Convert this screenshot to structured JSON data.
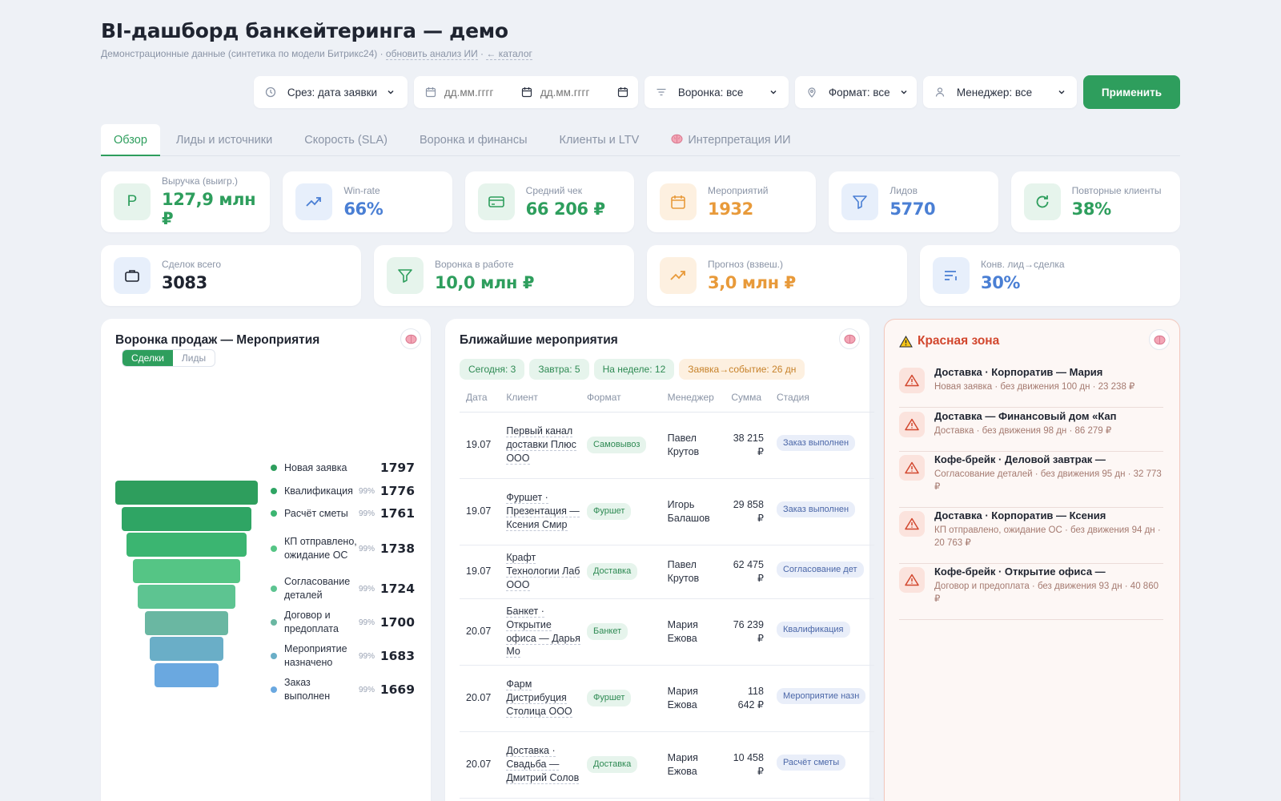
{
  "header": {
    "title": "BI-дашборд банкейтеринга — демо",
    "subtitle_prefix": "Демонстрационные данные (синтетика по модели Битрикс24) ·",
    "refresh_link": "обновить анализ ИИ",
    "separator": "·",
    "catalog_link": "← каталог"
  },
  "filters": {
    "slice": "Срез: дата заявки",
    "date_from_placeholder": "дд.мм.гггг",
    "date_to_placeholder": "дд.мм.гггг",
    "funnel": "Воронка: все",
    "format": "Формат: все",
    "manager": "Менеджер: все",
    "apply": "Применить"
  },
  "tabs": [
    {
      "label": "Обзор",
      "active": true
    },
    {
      "label": "Лиды и источники"
    },
    {
      "label": "Скорость (SLA)"
    },
    {
      "label": "Воронка и финансы"
    },
    {
      "label": "Клиенты и LTV"
    },
    {
      "label": "Интерпретация ИИ",
      "icon": "brain-icon"
    }
  ],
  "kpi_row1": [
    {
      "label": "Выручка (выигр.)",
      "value": "127,9 млн ₽",
      "color": "#2e9e5d",
      "bg": "#e6f4ec",
      "icon": "ruble-icon"
    },
    {
      "label": "Win-rate",
      "value": "66%",
      "color": "#4a7fd4",
      "bg": "#e7effb",
      "icon": "trend-up-icon"
    },
    {
      "label": "Средний чек",
      "value": "66 206 ₽",
      "color": "#2e9e5d",
      "bg": "#e6f4ec",
      "icon": "card-icon"
    },
    {
      "label": "Мероприятий",
      "value": "1932",
      "color": "#e89a3a",
      "bg": "#fdf0e0",
      "icon": "calendar-icon"
    },
    {
      "label": "Лидов",
      "value": "5770",
      "color": "#4a7fd4",
      "bg": "#e7effb",
      "icon": "filter-icon"
    },
    {
      "label": "Повторные клиенты",
      "value": "38%",
      "color": "#2e9e5d",
      "bg": "#e6f4ec",
      "icon": "refresh-icon"
    }
  ],
  "kpi_row2": [
    {
      "label": "Сделок всего",
      "value": "3083",
      "color": "#1f2430",
      "bg": "#e7effb",
      "icon": "briefcase-icon"
    },
    {
      "label": "Воронка в работе",
      "value": "10,0 млн ₽",
      "color": "#2e9e5d",
      "bg": "#e6f4ec",
      "icon": "filter-icon"
    },
    {
      "label": "Прогноз (взвеш.)",
      "value": "3,0 млн ₽",
      "color": "#e89a3a",
      "bg": "#fdf0e0",
      "icon": "trend-up-icon"
    },
    {
      "label": "Конв. лид→сделка",
      "value": "30%",
      "color": "#4a7fd4",
      "bg": "#e7effb",
      "icon": "list-icon"
    }
  ],
  "funnel_panel": {
    "title": "Воронка продаж — Мероприятия",
    "toggle_deals": "Сделки",
    "toggle_leads": "Лиды",
    "stages": [
      {
        "name": "Новая заявка",
        "pct": "",
        "value": 1797,
        "color": "#2e9e5d"
      },
      {
        "name": "Квалификация",
        "pct": "99%",
        "value": 1776,
        "color": "#2fa564"
      },
      {
        "name": "Расчёт сметы",
        "pct": "99%",
        "value": 1761,
        "color": "#3bb571"
      },
      {
        "name": "КП отправлено, ожидание ОС",
        "pct": "99%",
        "value": 1738,
        "color": "#55c585"
      },
      {
        "name": "Согласование деталей",
        "pct": "99%",
        "value": 1724,
        "color": "#5dc491"
      },
      {
        "name": "Договор и предоплата",
        "pct": "99%",
        "value": 1700,
        "color": "#6ab7a2"
      },
      {
        "name": "Мероприятие назначено",
        "pct": "99%",
        "value": 1683,
        "color": "#6aaec7"
      },
      {
        "name": "Заказ выполнен",
        "pct": "99%",
        "value": 1669,
        "color": "#6aa8e0"
      }
    ]
  },
  "events_panel": {
    "title": "Ближайшие мероприятия",
    "chips": [
      {
        "label": "Сегодня: 3",
        "bg": "#e6f4ec",
        "color": "#2e8a53"
      },
      {
        "label": "Завтра: 5",
        "bg": "#e6f4ec",
        "color": "#2e8a53"
      },
      {
        "label": "На неделе: 12",
        "bg": "#e6f4ec",
        "color": "#2e8a53"
      },
      {
        "label": "Заявка→событие: 26 дн",
        "bg": "#fdf0e0",
        "color": "#c7822a"
      }
    ],
    "columns": [
      "Дата",
      "Клиент",
      "Формат",
      "Менеджер",
      "Сумма",
      "Стадия"
    ],
    "rows": [
      {
        "date": "19.07",
        "client": "Первый канал доставки Плюс ООО",
        "format": "Самовывоз",
        "manager": "Павел Крутов",
        "sum": "38 215 ₽",
        "stage": "Заказ выполнен"
      },
      {
        "date": "19.07",
        "client": "Фуршет · Презентация — Ксения Смир",
        "format": "Фуршет",
        "manager": "Игорь Балашов",
        "sum": "29 858 ₽",
        "stage": "Заказ выполнен"
      },
      {
        "date": "19.07",
        "client": "Крафт Технологии Лаб ООО",
        "format": "Доставка",
        "manager": "Павел Крутов",
        "sum": "62 475 ₽",
        "stage": "Согласование дет"
      },
      {
        "date": "20.07",
        "client": "Банкет · Открытие офиса — Дарья Мо",
        "format": "Банкет",
        "manager": "Мария Ежова",
        "sum": "76 239 ₽",
        "stage": "Квалификация"
      },
      {
        "date": "20.07",
        "client": "Фарм Дистрибуция Столица ООО",
        "format": "Фуршет",
        "manager": "Мария Ежова",
        "sum": "118 642 ₽",
        "stage": "Мероприятие назн"
      },
      {
        "date": "20.07",
        "client": "Доставка · Свадьба — Дмитрий Солов",
        "format": "Доставка",
        "manager": "Мария Ежова",
        "sum": "10 458 ₽",
        "stage": "Расчёт сметы"
      }
    ]
  },
  "red_panel": {
    "title": "Красная зона",
    "items": [
      {
        "title": "Доставка · Корпоратив — Мария",
        "sub": "Новая заявка · без движения 100 дн · 23 238 ₽"
      },
      {
        "title": "Доставка — Финансовый дом «Кап",
        "sub": "Доставка · без движения 98 дн · 86 279 ₽"
      },
      {
        "title": "Кофе-брейк · Деловой завтрак —",
        "sub": "Согласование деталей · без движения 95 дн · 32 773 ₽"
      },
      {
        "title": "Доставка · Корпоратив — Ксения",
        "sub": "КП отправлено, ожидание ОС · без движения 94 дн · 20 763 ₽"
      },
      {
        "title": "Кофе-брейк · Открытие офиса —",
        "sub": "Договор и предоплата · без движения 93 дн · 40 860 ₽"
      }
    ]
  }
}
